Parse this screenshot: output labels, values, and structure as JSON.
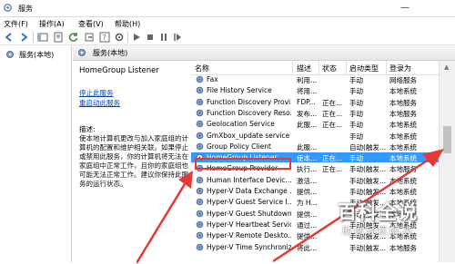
{
  "window": {
    "title": "服务",
    "controls": {
      "minimize": "—"
    }
  },
  "menu": [
    "文件(F)",
    "操作(A)",
    "查看(V)",
    "帮助(H)"
  ],
  "left_tree": {
    "item": "服务(本地)"
  },
  "right_header": {
    "label": "服务(本地)"
  },
  "detail": {
    "service_name": "HomeGroup Listener",
    "links": [
      "停止此服务",
      "重启动此服务"
    ],
    "desc_label": "描述:",
    "description": "使本地计算机更改与加入家庭组的计算机的配置和维护相关联。如果停止或禁用此服务，你的计算机将无法在家庭组中正常工作，且你的家庭组也可能无法正常工作。建议你保持此服务的运行状态。"
  },
  "list": {
    "columns": {
      "name": "名称",
      "desc": "描述",
      "status": "状态",
      "startup": "启动类型",
      "logon": "登录为"
    },
    "rows": [
      {
        "name": "Fax",
        "desc": "利用...",
        "status": "",
        "startup": "手动",
        "logon": "网络服务"
      },
      {
        "name": "File History Service",
        "desc": "将用...",
        "status": "",
        "startup": "手动",
        "logon": "本地系统"
      },
      {
        "name": "Function Discovery Provi...",
        "desc": "FDP...",
        "status": "正在...",
        "startup": "手动",
        "logon": "本地服务"
      },
      {
        "name": "Function Discovery Reso...",
        "desc": "发布...",
        "status": "正在...",
        "startup": "手动",
        "logon": "本地服务"
      },
      {
        "name": "Geolocation Service",
        "desc": "此服...",
        "status": "正在...",
        "startup": "手动",
        "logon": "本地系统"
      },
      {
        "name": "GmXbox_update service",
        "desc": "",
        "status": "",
        "startup": "手动",
        "logon": "本地系统"
      },
      {
        "name": "Group Policy Client",
        "desc": "此服...",
        "status": "",
        "startup": "自动(触发...",
        "logon": "本地系统"
      },
      {
        "name": "HomeGroup Listener",
        "desc": "使本...",
        "status": "正在...",
        "startup": "手动",
        "logon": "本地系统"
      },
      {
        "name": "HomeGroup Provider",
        "desc": "执行...",
        "status": "正在...",
        "startup": "手动(触发...",
        "logon": "本地服务"
      },
      {
        "name": "Human Interface Devic...",
        "desc": "激活...",
        "status": "",
        "startup": "手动(触发...",
        "logon": "本地系统"
      },
      {
        "name": "Hyper-V Data Exchange ...",
        "desc": "提供...",
        "status": "",
        "startup": "手动(触发...",
        "logon": "本地系统"
      },
      {
        "name": "Hyper-V Guest Service I...",
        "desc": "为 H...",
        "status": "",
        "startup": "手动(触发...",
        "logon": "本地系统"
      },
      {
        "name": "Hyper-V Guest Shutdown...",
        "desc": "提供...",
        "status": "",
        "startup": "手动(触发...",
        "logon": "本地系统"
      },
      {
        "name": "Hyper-V Heartbeat Service",
        "desc": "通过...",
        "status": "",
        "startup": "手动(触发...",
        "logon": "本地系统"
      },
      {
        "name": "Hyper-V Remote Deskto...",
        "desc": "提供...",
        "status": "",
        "startup": "手动(触发...",
        "logon": "本地系统"
      },
      {
        "name": "Hyper-V Time Synchroniz...",
        "desc": "将此...",
        "status": "",
        "startup": "手动(触发...",
        "logon": "本地服务"
      }
    ],
    "selected_index": 7
  },
  "watermark": {
    "logo": "百科全说",
    "sub": "助你轻松解决"
  },
  "colors": {
    "selection": "#3399ff",
    "highlight_box": "#e53935",
    "link": "#0645ad"
  },
  "icons": [
    "services-app-icon",
    "gear-icon",
    "back-arrow-icon",
    "forward-arrow-icon",
    "play-icon",
    "stop-icon",
    "pause-icon",
    "restart-icon"
  ]
}
